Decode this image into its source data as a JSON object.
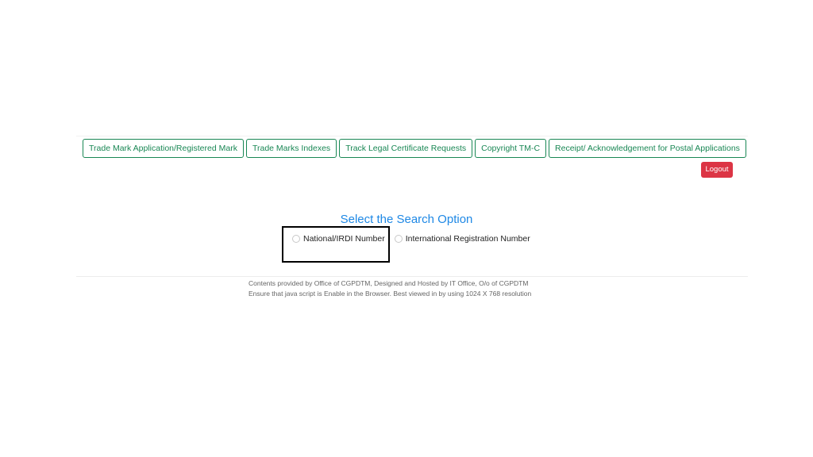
{
  "nav": {
    "items": [
      {
        "label": "Trade Mark Application/Registered Mark"
      },
      {
        "label": "Trade Marks Indexes"
      },
      {
        "label": "Track Legal Certificate Requests"
      },
      {
        "label": "Copyright TM-C"
      },
      {
        "label": "Receipt/ Acknowledgement for Postal Applications"
      }
    ],
    "accent_color": "#198754"
  },
  "logout": {
    "label": "Logout",
    "color": "#dc3545"
  },
  "search": {
    "title": "Select the Search Option",
    "title_color": "#1e88e5",
    "options": [
      {
        "label": "National/IRDI Number",
        "selected": false
      },
      {
        "label": "International Registration Number",
        "selected": false
      }
    ]
  },
  "footer": {
    "line1": "Contents provided by Office of CGPDTM, Designed and Hosted by IT Office, O/o of CGPDTM",
    "line2": "Ensure that java script is Enable in the Browser. Best viewed in by using 1024 X 768 resolution"
  }
}
